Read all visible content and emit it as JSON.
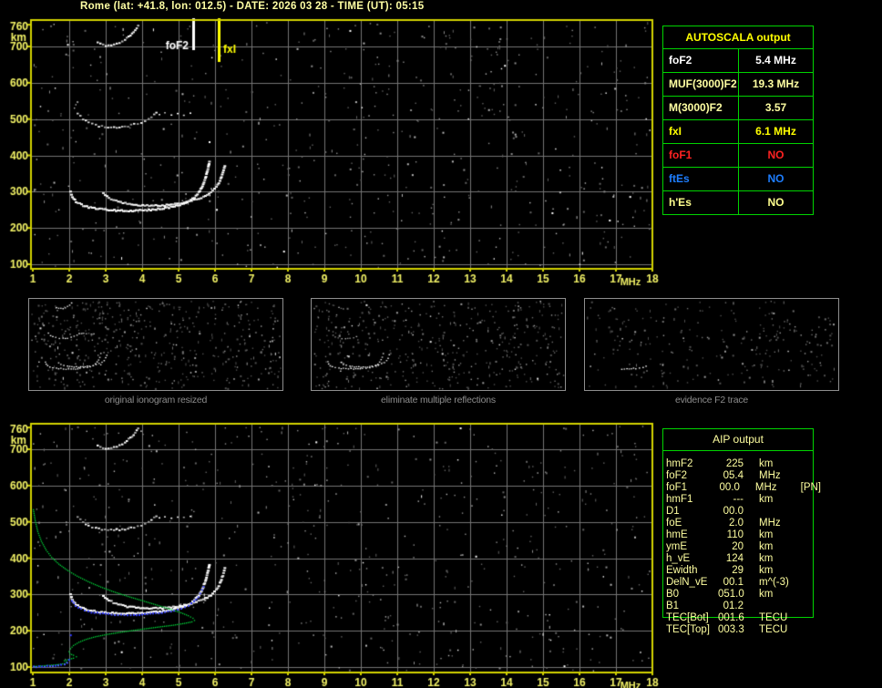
{
  "title": "Rome (lat: +41.8, lon: 012.5) - DATE: 2026 03 28 - TIME (UT): 05:15",
  "colors": {
    "background": "#000000",
    "title_text": "#ffffa4",
    "plot_border": "#d2d200",
    "axis_labels": "#f2f266",
    "grid": "#757575",
    "trace": "#ffffff",
    "green_profile": "#00d83a",
    "blue_fit": "#2b36ff",
    "table_border": "#00d400",
    "caption": "#8c8c8c"
  },
  "autoscala_table": {
    "header": "AUTOSCALA output",
    "header_color": "#ffff00",
    "rows": [
      {
        "label": "foF2",
        "value": "5.4 MHz",
        "color": "#ffffff"
      },
      {
        "label": "MUF(3000)F2",
        "value": "19.3 MHz",
        "color": "#ffffa2"
      },
      {
        "label": "M(3000)F2",
        "value": "3.57",
        "color": "#ffffa2"
      },
      {
        "label": "fxI",
        "value": "6.1 MHz",
        "color": "#ffff00"
      },
      {
        "label": "foF1",
        "value": "NO",
        "color": "#ff2222"
      },
      {
        "label": "ftEs",
        "value": "NO",
        "color": "#1e7eff"
      },
      {
        "label": "h'Es",
        "value": "NO",
        "color": "#ffff8e"
      }
    ]
  },
  "aip_table": {
    "header": "AIP output",
    "text_color": "#ffffa0",
    "rows": [
      {
        "label": "hmF2",
        "value": "225",
        "unit": "km",
        "extra": ""
      },
      {
        "label": "foF2",
        "value": "05.4",
        "unit": "MHz",
        "extra": ""
      },
      {
        "label": "foF1",
        "value": "00.0",
        "unit": "MHz",
        "extra": "[PN]"
      },
      {
        "label": "hmF1",
        "value": "---",
        "unit": "km",
        "extra": ""
      },
      {
        "label": "D1",
        "value": "00.0",
        "unit": "",
        "extra": ""
      },
      {
        "label": "foE",
        "value": "2.0",
        "unit": "MHz",
        "extra": ""
      },
      {
        "label": "hmE",
        "value": "110",
        "unit": "km",
        "extra": ""
      },
      {
        "label": "ymE",
        "value": "20",
        "unit": "km",
        "extra": ""
      },
      {
        "label": "h_vE",
        "value": "124",
        "unit": "km",
        "extra": ""
      },
      {
        "label": "Ewidth",
        "value": "29",
        "unit": "km",
        "extra": ""
      },
      {
        "label": "DelN_vE",
        "value": "00.1",
        "unit": "m^(-3)",
        "extra": ""
      },
      {
        "label": "B0",
        "value": "051.0",
        "unit": "km",
        "extra": ""
      },
      {
        "label": "B1",
        "value": "01.2",
        "unit": "",
        "extra": ""
      },
      {
        "label": "TEC[Bot]",
        "value": "001.6",
        "unit": "TECU",
        "extra": ""
      },
      {
        "label": "TEC[Top]",
        "value": "003.3",
        "unit": "TECU",
        "extra": ""
      }
    ]
  },
  "thumbnails": [
    {
      "caption": "original ionogram resized"
    },
    {
      "caption": "eliminate multiple reflections"
    },
    {
      "caption": "evidence F2 trace"
    }
  ],
  "chart_data": {
    "type": "scatter",
    "title": "ionogram (virtual height vs frequency)",
    "xlabel": "MHz",
    "ylabel": "km",
    "xlim": [
      1,
      18
    ],
    "ylim": [
      100,
      760
    ],
    "xticks": [
      1,
      2,
      3,
      4,
      5,
      6,
      7,
      8,
      9,
      10,
      11,
      12,
      13,
      14,
      15,
      16,
      17,
      18
    ],
    "yticks": [
      100,
      200,
      300,
      400,
      500,
      600,
      700,
      760
    ],
    "grid": true,
    "markers": [
      {
        "label": "foF2",
        "freq_mhz": 5.4,
        "color": "#ffffff"
      },
      {
        "label": "fxI",
        "freq_mhz": 6.1,
        "color": "#ffff00"
      }
    ],
    "traces": {
      "f2_ordinary": [
        [
          2.0,
          302
        ],
        [
          2.05,
          288
        ],
        [
          2.15,
          275
        ],
        [
          2.3,
          266
        ],
        [
          2.5,
          259
        ],
        [
          2.75,
          255
        ],
        [
          3.05,
          252
        ],
        [
          3.4,
          250
        ],
        [
          3.75,
          250
        ],
        [
          4.05,
          251
        ],
        [
          4.35,
          254
        ],
        [
          4.6,
          257
        ],
        [
          4.85,
          262
        ],
        [
          5.05,
          268
        ],
        [
          5.25,
          276
        ],
        [
          5.4,
          287
        ],
        [
          5.52,
          300
        ],
        [
          5.62,
          318
        ],
        [
          5.7,
          340
        ],
        [
          5.77,
          365
        ],
        [
          5.82,
          390
        ]
      ],
      "f2_extraordinary": [
        [
          2.9,
          298
        ],
        [
          3.05,
          286
        ],
        [
          3.25,
          277
        ],
        [
          3.5,
          270
        ],
        [
          3.8,
          266
        ],
        [
          4.1,
          264
        ],
        [
          4.4,
          264
        ],
        [
          4.7,
          266
        ],
        [
          5.0,
          270
        ],
        [
          5.25,
          275
        ],
        [
          5.45,
          281
        ],
        [
          5.65,
          289
        ],
        [
          5.85,
          300
        ],
        [
          6.0,
          315
        ],
        [
          6.1,
          333
        ],
        [
          6.18,
          355
        ],
        [
          6.25,
          380
        ]
      ],
      "f2_second_hop": [
        [
          2.2,
          518
        ],
        [
          2.35,
          502
        ],
        [
          2.5,
          492
        ],
        [
          2.7,
          485
        ],
        [
          2.95,
          481
        ],
        [
          3.2,
          480
        ],
        [
          3.5,
          482
        ],
        [
          3.75,
          487
        ],
        [
          3.95,
          494
        ],
        [
          4.15,
          503
        ],
        [
          4.3,
          514
        ],
        [
          4.42,
          524
        ]
      ],
      "upper_multiple": [
        [
          2.75,
          712
        ],
        [
          2.9,
          706
        ],
        [
          3.05,
          704
        ],
        [
          3.2,
          707
        ],
        [
          3.35,
          713
        ],
        [
          3.5,
          722
        ],
        [
          3.65,
          734
        ],
        [
          3.78,
          748
        ],
        [
          3.9,
          764
        ]
      ],
      "mid_segment": [
        [
          4.45,
          514
        ],
        [
          4.6,
          517
        ],
        [
          4.78,
          513
        ],
        [
          4.95,
          517
        ],
        [
          5.12,
          514
        ],
        [
          5.3,
          517
        ],
        [
          5.45,
          515
        ]
      ]
    },
    "aip_overlay": {
      "electron_density_profile_green": [
        [
          1.0,
          535
        ],
        [
          1.05,
          505
        ],
        [
          1.12,
          475
        ],
        [
          1.22,
          448
        ],
        [
          1.35,
          424
        ],
        [
          1.5,
          404
        ],
        [
          1.7,
          385
        ],
        [
          1.95,
          367
        ],
        [
          2.2,
          352
        ],
        [
          2.5,
          337
        ],
        [
          2.85,
          322
        ],
        [
          3.2,
          309
        ],
        [
          3.6,
          296
        ],
        [
          4.0,
          284
        ],
        [
          4.4,
          272
        ],
        [
          4.75,
          261
        ],
        [
          5.05,
          251
        ],
        [
          5.25,
          243
        ],
        [
          5.38,
          236
        ],
        [
          5.42,
          230
        ],
        [
          5.35,
          226
        ],
        [
          5.15,
          222
        ],
        [
          4.85,
          217
        ],
        [
          4.45,
          212
        ],
        [
          4.0,
          206
        ],
        [
          3.5,
          199
        ],
        [
          3.05,
          192
        ],
        [
          2.7,
          185
        ],
        [
          2.45,
          178
        ],
        [
          2.25,
          170
        ],
        [
          2.1,
          161
        ],
        [
          2.02,
          152
        ],
        [
          1.98,
          144
        ],
        [
          2.0,
          138
        ],
        [
          2.1,
          134
        ],
        [
          2.18,
          130
        ],
        [
          2.1,
          126
        ],
        [
          1.95,
          122
        ],
        [
          1.85,
          119
        ],
        [
          1.9,
          115
        ],
        [
          1.85,
          111
        ],
        [
          1.65,
          108
        ],
        [
          1.4,
          106
        ],
        [
          1.15,
          104
        ],
        [
          1.0,
          103
        ]
      ],
      "blue_fit_f2": [
        [
          2.05,
          284
        ],
        [
          2.15,
          271
        ],
        [
          2.3,
          262
        ],
        [
          2.5,
          255
        ],
        [
          2.75,
          251
        ],
        [
          3.05,
          248
        ],
        [
          3.4,
          246
        ],
        [
          3.75,
          246
        ],
        [
          4.05,
          247
        ],
        [
          4.35,
          250
        ],
        [
          4.6,
          253
        ],
        [
          4.85,
          258
        ],
        [
          5.05,
          264
        ],
        [
          5.25,
          272
        ],
        [
          5.4,
          283
        ],
        [
          5.52,
          296
        ],
        [
          5.62,
          314
        ],
        [
          5.7,
          333
        ]
      ],
      "blue_fit_e": [
        [
          1.0,
          103
        ],
        [
          1.15,
          104
        ],
        [
          1.3,
          104
        ],
        [
          1.45,
          105
        ],
        [
          1.6,
          106
        ],
        [
          1.75,
          108
        ],
        [
          1.85,
          110
        ],
        [
          1.92,
          114
        ],
        [
          1.97,
          121
        ],
        [
          2.0,
          130
        ]
      ],
      "blue_isolated_point": [
        2.02,
        190
      ]
    }
  }
}
